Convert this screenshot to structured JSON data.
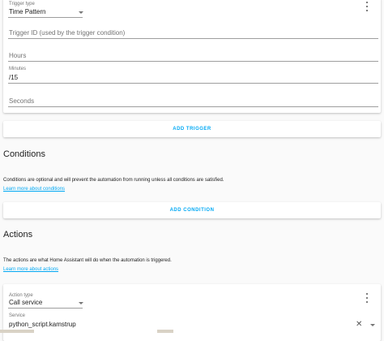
{
  "trigger": {
    "type_label": "Trigger type",
    "type_value": "Time Pattern",
    "trigger_id_placeholder": "Trigger ID (used by the trigger condition)",
    "hours_placeholder": "Hours",
    "minutes_label": "Minutes",
    "minutes_value": "/15",
    "seconds_placeholder": "Seconds",
    "menu_icon": "more-vert-icon"
  },
  "add_trigger_label": "Add Trigger",
  "conditions": {
    "title": "Conditions",
    "description": "Conditions are optional and will prevent the automation from running unless all conditions are satisfied.",
    "learn_more": "Learn more about conditions",
    "add_label": "Add Condition"
  },
  "actions": {
    "title": "Actions",
    "description": "The actions are what Home Assistant will do when the automation is triggered.",
    "learn_more": "Learn more about actions"
  },
  "action": {
    "type_label": "Action type",
    "type_value": "Call service",
    "service_label": "Service",
    "service_value": "python_script.kamstrup",
    "menu_icon": "more-vert-icon",
    "clear_icon": "close-icon",
    "dropdown_icon": "chevron-down-icon"
  },
  "colors": {
    "accent": "#03a9f4",
    "background": "#fafafa",
    "card": "#ffffff"
  }
}
